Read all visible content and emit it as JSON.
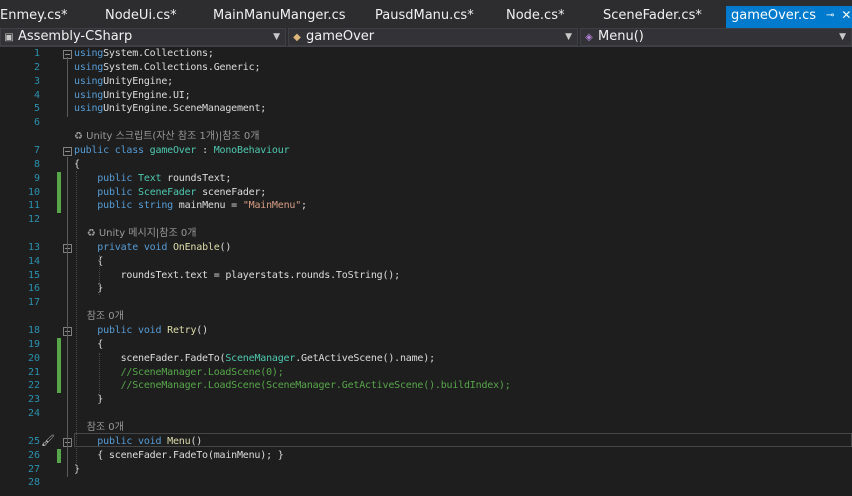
{
  "tabs": [
    {
      "label": "Enmey.cs*"
    },
    {
      "label": "NodeUi.cs*"
    },
    {
      "label": "MainManuManger.cs"
    },
    {
      "label": "PausdManu.cs*"
    },
    {
      "label": "Node.cs*"
    },
    {
      "label": "SceneFader.cs*"
    },
    {
      "label": "gameOver.cs",
      "active": true
    }
  ],
  "navbar": {
    "project": "Assembly-CSharp",
    "class": "gameOver",
    "member": "Menu()"
  },
  "lines": [
    {
      "n": "1",
      "tokens": [
        [
          "kw",
          "using"
        ],
        [
          "",
          "System.Collections;"
        ]
      ]
    },
    {
      "n": "2",
      "tokens": [
        [
          "kw",
          "using"
        ],
        [
          "",
          "System.Collections.Generic;"
        ]
      ]
    },
    {
      "n": "3",
      "tokens": [
        [
          "kw",
          "using"
        ],
        [
          "",
          "UnityEngine;"
        ]
      ]
    },
    {
      "n": "4",
      "tokens": [
        [
          "kw",
          "using"
        ],
        [
          "",
          "UnityEngine.UI;"
        ]
      ]
    },
    {
      "n": "5",
      "tokens": [
        [
          "kw",
          "using"
        ],
        [
          "",
          "UnityEngine.SceneManagement;"
        ]
      ]
    },
    {
      "n": "6",
      "tokens": []
    },
    {
      "n": "",
      "lens": "♻ Unity 스크립트(자산 참조 1개)|참조 0개"
    },
    {
      "n": "7",
      "tokens": [
        [
          "kw",
          "public class "
        ],
        [
          "ty",
          "gameOver"
        ],
        [
          "",
          " : "
        ],
        [
          "ty",
          "MonoBehaviour"
        ]
      ]
    },
    {
      "n": "8",
      "tokens": [
        [
          "",
          "{"
        ]
      ]
    },
    {
      "n": "9",
      "tokens": [
        [
          "",
          "    "
        ],
        [
          "kw",
          "public "
        ],
        [
          "ty",
          "Text"
        ],
        [
          "",
          " roundsText;"
        ]
      ]
    },
    {
      "n": "10",
      "tokens": [
        [
          "",
          "    "
        ],
        [
          "kw",
          "public "
        ],
        [
          "ty",
          "SceneFader"
        ],
        [
          "",
          " sceneFader;"
        ]
      ]
    },
    {
      "n": "11",
      "tokens": [
        [
          "",
          "    "
        ],
        [
          "kw",
          "public string "
        ],
        [
          "",
          "mainMenu = "
        ],
        [
          "st",
          "\"MainMenu\""
        ],
        [
          "",
          ";"
        ]
      ]
    },
    {
      "n": "12",
      "tokens": []
    },
    {
      "n": "",
      "lens": "    ♻ Unity 메시지|참조 0개"
    },
    {
      "n": "13",
      "tokens": [
        [
          "",
          "    "
        ],
        [
          "kw",
          "private void "
        ],
        [
          "fn",
          "OnEnable"
        ],
        [
          "",
          "()"
        ]
      ]
    },
    {
      "n": "14",
      "tokens": [
        [
          "",
          "    {"
        ]
      ]
    },
    {
      "n": "15",
      "tokens": [
        [
          "",
          "        roundsText.text = playerstats.rounds.ToString();"
        ]
      ]
    },
    {
      "n": "16",
      "tokens": [
        [
          "",
          "    }"
        ]
      ]
    },
    {
      "n": "17",
      "tokens": []
    },
    {
      "n": "",
      "lens": "    참조 0개"
    },
    {
      "n": "18",
      "tokens": [
        [
          "",
          "    "
        ],
        [
          "kw",
          "public void "
        ],
        [
          "fn",
          "Retry"
        ],
        [
          "",
          "()"
        ]
      ]
    },
    {
      "n": "19",
      "tokens": [
        [
          "",
          "    {"
        ]
      ]
    },
    {
      "n": "20",
      "tokens": [
        [
          "",
          "        sceneFader.FadeTo("
        ],
        [
          "ty",
          "SceneManager"
        ],
        [
          "",
          ".GetActiveScene().name);"
        ]
      ]
    },
    {
      "n": "21",
      "tokens": [
        [
          "",
          "        "
        ],
        [
          "cm",
          "//SceneManager.LoadScene(0);"
        ]
      ]
    },
    {
      "n": "22",
      "tokens": [
        [
          "",
          "        "
        ],
        [
          "cm",
          "//SceneManager.LoadScene(SceneManager.GetActiveScene().buildIndex);"
        ]
      ]
    },
    {
      "n": "23",
      "tokens": [
        [
          "",
          "    }"
        ]
      ]
    },
    {
      "n": "24",
      "tokens": []
    },
    {
      "n": "",
      "lens": "    참조 0개"
    },
    {
      "n": "25",
      "tokens": [
        [
          "",
          "    "
        ],
        [
          "kw",
          "public void "
        ],
        [
          "fn",
          "Menu"
        ],
        [
          "",
          "()"
        ]
      ]
    },
    {
      "n": "26",
      "tokens": [
        [
          "",
          "    { sceneFader.FadeTo(mainMenu); }"
        ]
      ]
    },
    {
      "n": "27",
      "tokens": [
        [
          "",
          "}"
        ]
      ]
    },
    {
      "n": "28",
      "tokens": []
    }
  ],
  "colors": {
    "keyword": "#569cd6",
    "type": "#4ec9b0",
    "string": "#d69d85",
    "comment": "#57a64a",
    "accent": "#007acc"
  }
}
